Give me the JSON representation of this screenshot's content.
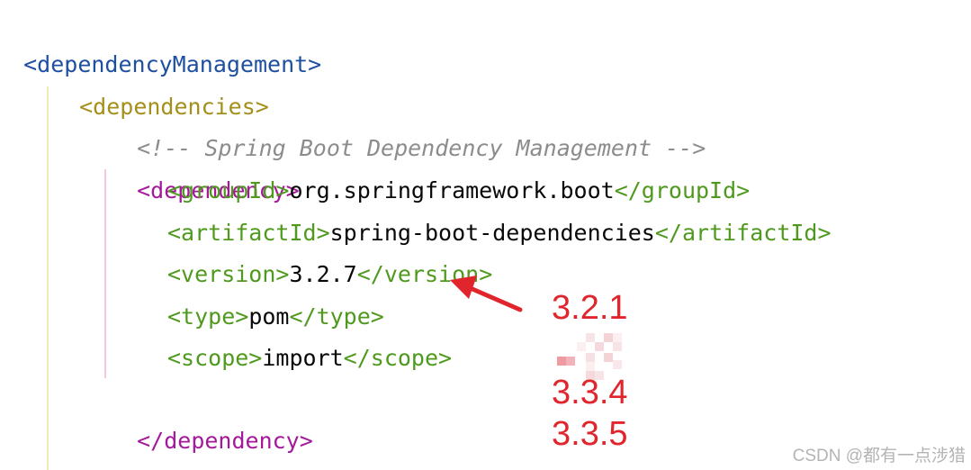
{
  "editor": {
    "lines": {
      "depmgmt_open": "<dependencyManagement>",
      "deps_open": "<dependencies>",
      "comment": "<!-- Spring Boot Dependency Management -->",
      "dep_open": "<dependency>",
      "groupId_open": "<groupId>",
      "groupId_value": "org.springframework.boot",
      "groupId_close": "</groupId>",
      "artifactId_open": "<artifactId>",
      "artifactId_value": "spring-boot-dependencies",
      "artifactId_close": "</artifactId>",
      "version_open": "<version>",
      "version_value": "3.2.7",
      "version_close": "</version>",
      "type_open": "<type>",
      "type_value": "pom",
      "type_close": "</type>",
      "scope_open": "<scope>",
      "scope_value": "import",
      "scope_close": "</scope>",
      "dep_close": "</dependency>"
    }
  },
  "annotations": {
    "versions": [
      "3.2.1",
      "3.3.4",
      "3.3.5"
    ],
    "color": "#e0262c"
  },
  "watermark": "CSDN @都有一点涉猎",
  "colors": {
    "tag_outer": "#1e4fa0",
    "tag_dependencies": "#a48f1a",
    "tag_dependency": "#a3199a",
    "tag_inner": "#4f9a1e",
    "comment": "#8c8c8c"
  }
}
